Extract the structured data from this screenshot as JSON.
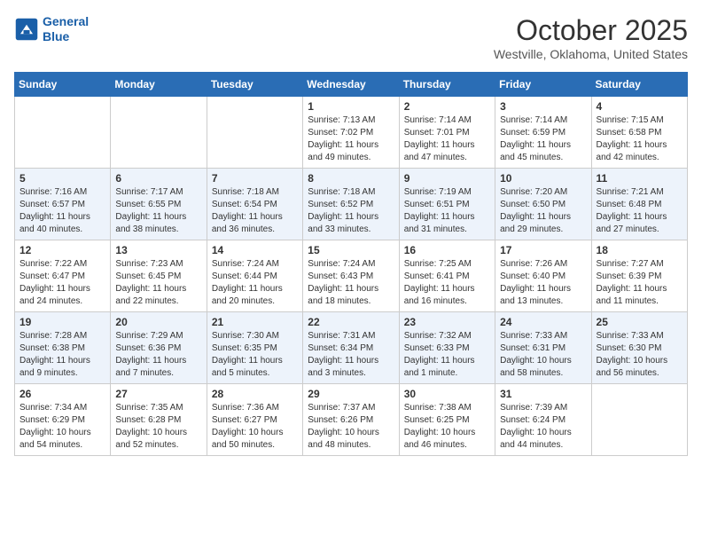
{
  "header": {
    "logo_line1": "General",
    "logo_line2": "Blue",
    "month": "October 2025",
    "location": "Westville, Oklahoma, United States"
  },
  "weekdays": [
    "Sunday",
    "Monday",
    "Tuesday",
    "Wednesday",
    "Thursday",
    "Friday",
    "Saturday"
  ],
  "weeks": [
    [
      {
        "day": "",
        "info": ""
      },
      {
        "day": "",
        "info": ""
      },
      {
        "day": "",
        "info": ""
      },
      {
        "day": "1",
        "info": "Sunrise: 7:13 AM\nSunset: 7:02 PM\nDaylight: 11 hours\nand 49 minutes."
      },
      {
        "day": "2",
        "info": "Sunrise: 7:14 AM\nSunset: 7:01 PM\nDaylight: 11 hours\nand 47 minutes."
      },
      {
        "day": "3",
        "info": "Sunrise: 7:14 AM\nSunset: 6:59 PM\nDaylight: 11 hours\nand 45 minutes."
      },
      {
        "day": "4",
        "info": "Sunrise: 7:15 AM\nSunset: 6:58 PM\nDaylight: 11 hours\nand 42 minutes."
      }
    ],
    [
      {
        "day": "5",
        "info": "Sunrise: 7:16 AM\nSunset: 6:57 PM\nDaylight: 11 hours\nand 40 minutes."
      },
      {
        "day": "6",
        "info": "Sunrise: 7:17 AM\nSunset: 6:55 PM\nDaylight: 11 hours\nand 38 minutes."
      },
      {
        "day": "7",
        "info": "Sunrise: 7:18 AM\nSunset: 6:54 PM\nDaylight: 11 hours\nand 36 minutes."
      },
      {
        "day": "8",
        "info": "Sunrise: 7:18 AM\nSunset: 6:52 PM\nDaylight: 11 hours\nand 33 minutes."
      },
      {
        "day": "9",
        "info": "Sunrise: 7:19 AM\nSunset: 6:51 PM\nDaylight: 11 hours\nand 31 minutes."
      },
      {
        "day": "10",
        "info": "Sunrise: 7:20 AM\nSunset: 6:50 PM\nDaylight: 11 hours\nand 29 minutes."
      },
      {
        "day": "11",
        "info": "Sunrise: 7:21 AM\nSunset: 6:48 PM\nDaylight: 11 hours\nand 27 minutes."
      }
    ],
    [
      {
        "day": "12",
        "info": "Sunrise: 7:22 AM\nSunset: 6:47 PM\nDaylight: 11 hours\nand 24 minutes."
      },
      {
        "day": "13",
        "info": "Sunrise: 7:23 AM\nSunset: 6:45 PM\nDaylight: 11 hours\nand 22 minutes."
      },
      {
        "day": "14",
        "info": "Sunrise: 7:24 AM\nSunset: 6:44 PM\nDaylight: 11 hours\nand 20 minutes."
      },
      {
        "day": "15",
        "info": "Sunrise: 7:24 AM\nSunset: 6:43 PM\nDaylight: 11 hours\nand 18 minutes."
      },
      {
        "day": "16",
        "info": "Sunrise: 7:25 AM\nSunset: 6:41 PM\nDaylight: 11 hours\nand 16 minutes."
      },
      {
        "day": "17",
        "info": "Sunrise: 7:26 AM\nSunset: 6:40 PM\nDaylight: 11 hours\nand 13 minutes."
      },
      {
        "day": "18",
        "info": "Sunrise: 7:27 AM\nSunset: 6:39 PM\nDaylight: 11 hours\nand 11 minutes."
      }
    ],
    [
      {
        "day": "19",
        "info": "Sunrise: 7:28 AM\nSunset: 6:38 PM\nDaylight: 11 hours\nand 9 minutes."
      },
      {
        "day": "20",
        "info": "Sunrise: 7:29 AM\nSunset: 6:36 PM\nDaylight: 11 hours\nand 7 minutes."
      },
      {
        "day": "21",
        "info": "Sunrise: 7:30 AM\nSunset: 6:35 PM\nDaylight: 11 hours\nand 5 minutes."
      },
      {
        "day": "22",
        "info": "Sunrise: 7:31 AM\nSunset: 6:34 PM\nDaylight: 11 hours\nand 3 minutes."
      },
      {
        "day": "23",
        "info": "Sunrise: 7:32 AM\nSunset: 6:33 PM\nDaylight: 11 hours\nand 1 minute."
      },
      {
        "day": "24",
        "info": "Sunrise: 7:33 AM\nSunset: 6:31 PM\nDaylight: 10 hours\nand 58 minutes."
      },
      {
        "day": "25",
        "info": "Sunrise: 7:33 AM\nSunset: 6:30 PM\nDaylight: 10 hours\nand 56 minutes."
      }
    ],
    [
      {
        "day": "26",
        "info": "Sunrise: 7:34 AM\nSunset: 6:29 PM\nDaylight: 10 hours\nand 54 minutes."
      },
      {
        "day": "27",
        "info": "Sunrise: 7:35 AM\nSunset: 6:28 PM\nDaylight: 10 hours\nand 52 minutes."
      },
      {
        "day": "28",
        "info": "Sunrise: 7:36 AM\nSunset: 6:27 PM\nDaylight: 10 hours\nand 50 minutes."
      },
      {
        "day": "29",
        "info": "Sunrise: 7:37 AM\nSunset: 6:26 PM\nDaylight: 10 hours\nand 48 minutes."
      },
      {
        "day": "30",
        "info": "Sunrise: 7:38 AM\nSunset: 6:25 PM\nDaylight: 10 hours\nand 46 minutes."
      },
      {
        "day": "31",
        "info": "Sunrise: 7:39 AM\nSunset: 6:24 PM\nDaylight: 10 hours\nand 44 minutes."
      },
      {
        "day": "",
        "info": ""
      }
    ]
  ]
}
